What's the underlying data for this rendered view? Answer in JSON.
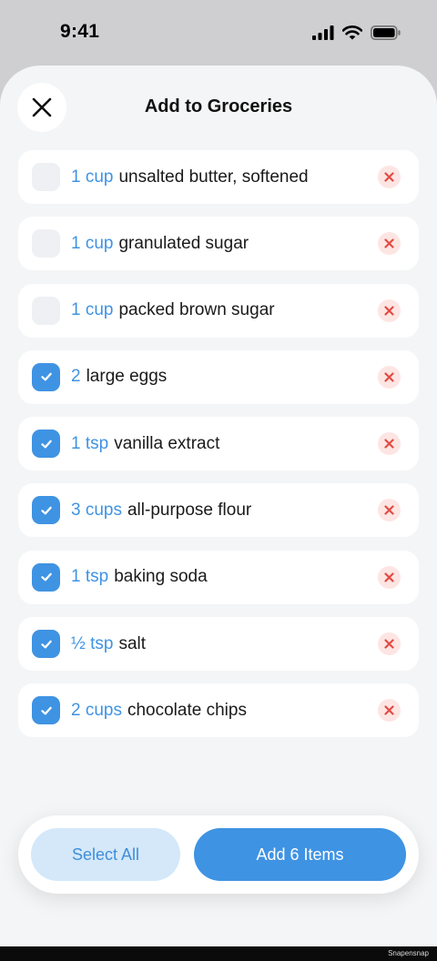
{
  "status": {
    "time": "9:41"
  },
  "sheet": {
    "title": "Add to Groceries",
    "close_icon": "close-icon"
  },
  "items": [
    {
      "qty": "1 cup",
      "name": "unsalted butter, softened",
      "checked": false
    },
    {
      "qty": "1 cup",
      "name": "granulated sugar",
      "checked": false
    },
    {
      "qty": "1 cup",
      "name": "packed brown sugar",
      "checked": false
    },
    {
      "qty": "2",
      "name": "large eggs",
      "checked": true
    },
    {
      "qty": "1 tsp",
      "name": "vanilla extract",
      "checked": true
    },
    {
      "qty": "3 cups",
      "name": "all-purpose flour",
      "checked": true
    },
    {
      "qty": "1 tsp",
      "name": "baking soda",
      "checked": true
    },
    {
      "qty": "½ tsp",
      "name": "salt",
      "checked": true
    },
    {
      "qty": "2 cups",
      "name": "chocolate chips",
      "checked": true
    }
  ],
  "actions": {
    "select_all_label": "Select All",
    "add_label": "Add 6 Items"
  },
  "footer": {
    "watermark": "Snapensnap"
  },
  "colors": {
    "accent": "#3f93e3",
    "accent_light": "#d4e8f9",
    "danger": "#e24b43",
    "danger_bg": "#fde5e3"
  }
}
